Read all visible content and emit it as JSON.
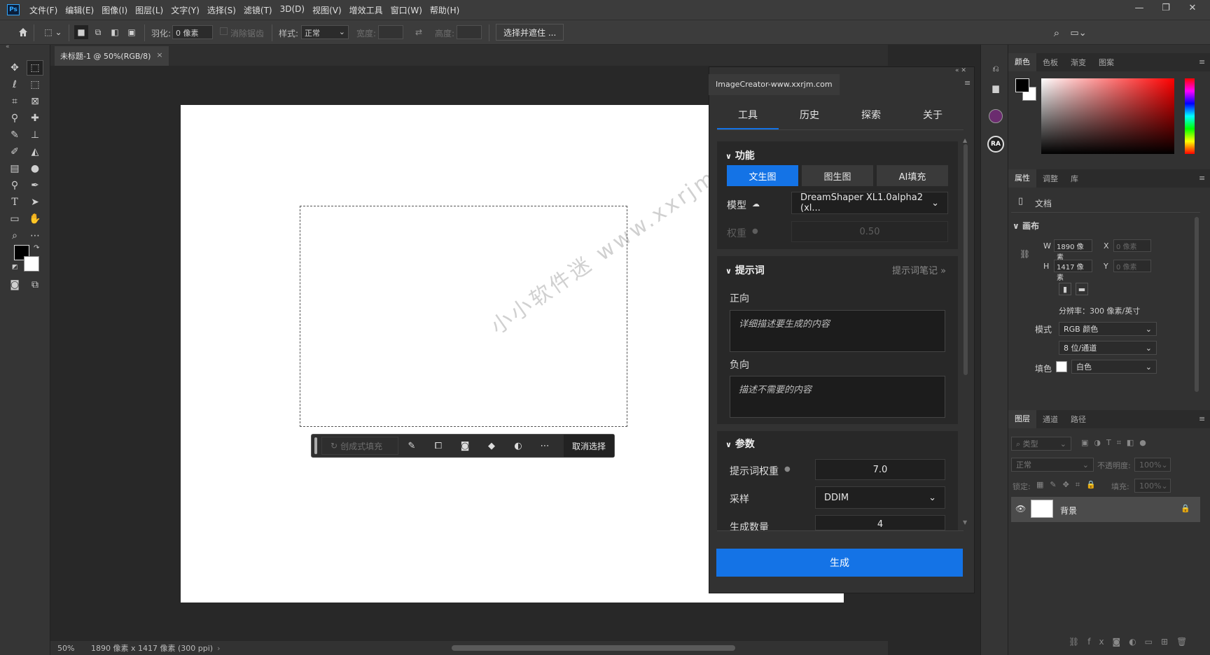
{
  "menu": {
    "logo": "Ps",
    "items": [
      "文件(F)",
      "编辑(E)",
      "图像(I)",
      "图层(L)",
      "文字(Y)",
      "选择(S)",
      "滤镜(T)",
      "3D(D)",
      "视图(V)",
      "增效工具",
      "窗口(W)",
      "帮助(H)"
    ],
    "window_controls": {
      "minimize": "—",
      "restore": "❐",
      "close": "✕"
    }
  },
  "options": {
    "feather_label": "羽化:",
    "feather_value": "0 像素",
    "antialias_label": "消除锯齿",
    "style_label": "样式:",
    "style_value": "正常",
    "width_label": "宽度:",
    "height_label": "高度:",
    "select_mask_label": "选择并遮住 ..."
  },
  "document": {
    "tab_title": "未标题-1 @ 50%(RGB/8)",
    "tab_close": "×",
    "zoom": "50%",
    "doc_info": "1890 像素 x 1417 像素 (300 ppi)"
  },
  "watermark": "小小软件迷 www.xxrjm.com",
  "context_bar": {
    "generative_fill_label": "创成式填充",
    "deselect_label": "取消选择"
  },
  "plugin": {
    "tab_title": "ImageCreator-www.xxrjm.com",
    "nav": [
      "工具",
      "历史",
      "探索",
      "关于"
    ],
    "func_title": "功能",
    "func_buttons": [
      "文生图",
      "图生图",
      "AI填充"
    ],
    "model_label": "模型",
    "model_value": "DreamShaper XL1.0alpha2 (xl...",
    "weight_label": "权重",
    "weight_value": "0.50",
    "prompt_title": "提示词",
    "prompt_notes_link": "提示词笔记 »",
    "positive_label": "正向",
    "positive_placeholder": "详细描述要生成的内容",
    "negative_label": "负向",
    "negative_placeholder": "描述不需要的内容",
    "params_title": "参数",
    "prompt_weight_label": "提示词权重",
    "prompt_weight_value": "7.0",
    "sampler_label": "采样",
    "sampler_value": "DDIM",
    "count_label": "生成数量",
    "count_value": "4",
    "generate_label": "生成"
  },
  "right": {
    "color_tabs": [
      "颜色",
      "色板",
      "渐变",
      "图案"
    ],
    "props_tabs": [
      "属性",
      "调整",
      "库"
    ],
    "doc_label": "文档",
    "canvas_section": "画布",
    "w_label": "W",
    "w_value": "1890 像素",
    "h_label": "H",
    "h_value": "1417 像素",
    "x_label": "X",
    "x_placeholder": "0 像素",
    "y_label": "Y",
    "y_placeholder": "0 像素",
    "resolution": "分辨率：300 像素/英寸",
    "mode_label": "模式",
    "mode_value": "RGB 颜色",
    "depth_value": "8 位/通道",
    "fill_label": "填色",
    "fill_value": "白色",
    "layers_tabs": [
      "图层",
      "通道",
      "路径"
    ],
    "kind_placeholder": "类型",
    "blend_value": "正常",
    "opacity_label": "不透明度:",
    "opacity_value": "100%",
    "lock_label": "锁定:",
    "fill_pct_label": "填充:",
    "fill_pct_value": "100%",
    "layer_name": "背景"
  },
  "colors": {
    "accent": "#1473e6",
    "panel": "#323232",
    "canvas": "#ffffff"
  }
}
